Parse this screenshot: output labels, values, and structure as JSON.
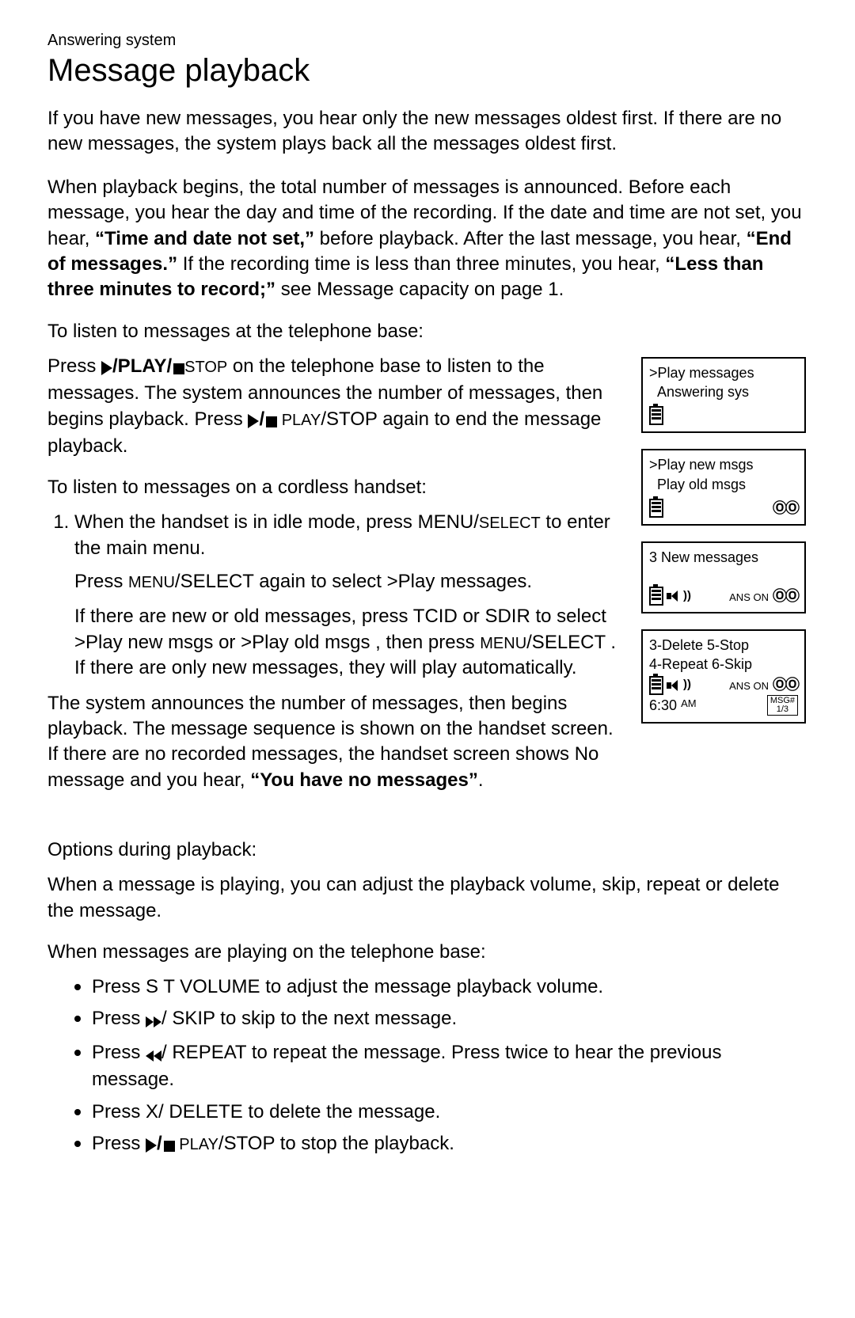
{
  "breadcrumb": "Answering system",
  "title": "Message playback",
  "p1": "If you have new messages, you hear only the new messages oldest first. If there are no new messages, the system plays back all the messages oldest first.",
  "p2_a": "When playback begins, the total number of messages is announced. Before each message, you hear the day and time of the recording. If the date and time are not set, you hear, ",
  "p2_bold1": "“Time and date not set,”",
  "p2_b": " before playback. After the last message, you hear, ",
  "p2_bold2": "“End of messages.”",
  "p2_c": " If the recording time is less than three minutes, you hear, ",
  "p2_bold3": "“Less than three minutes to record;”",
  "p2_d": " see ",
  "p2_span": "Message capacity",
  "p2_e": " on page 1.",
  "h_base": "To listen to messages at the telephone base:",
  "p_base_a": "Press ",
  "ps_label_big": "/PLAY/",
  "ps_label_stop": "STOP",
  "p_base_b": " on the telephone base to listen to the messages. The system announces the number of messages, then begins playback. Press ",
  "ps_label_small_a": "/",
  "ps_label_small_b": " PLAY",
  "ps_label_small_c": "/STOP",
  "p_base_c": " again to end the message playback.",
  "h_hand": "To listen to messages on a cordless handset:",
  "step1_a": "When the handset is in idle mode, press ",
  "step1_menu": "MENU/",
  "step1_select": "SELECT",
  "step1_b": " to enter the main menu.",
  "step_sub1_a": "Press ",
  "step_sub1_menu": "MENU",
  "step_sub1_select": "/SELECT",
  "step_sub1_b": " again to select ",
  "step_sub1_play": ">Play messages",
  "step_sub1_c": ".",
  "step_sub2_a": "If there are new or old messages, press ",
  "step_sub2_tcid": "TCID",
  "step_sub2_or": " or ",
  "step_sub2_sdir": "SDIR",
  "step_sub2_b": " to select ",
  "step_sub2_new": ">Play new msgs",
  "step_sub2_c": " or ",
  "step_sub2_old": ">Play old msgs",
  "step_sub2_d": ", then press ",
  "step_sub2_menu": "MENU",
  "step_sub2_sel": "/SELECT",
  "step_sub2_e": ". If there are only new messages, they will play automatically.",
  "p_ann_a": "The system announces the number of messages, then begins playback. The message sequence is shown on the handset screen. If there are no recorded messages, the handset screen shows ",
  "p_ann_nomsg": "No message",
  "p_ann_b": " and you hear, ",
  "p_ann_bold": "“You have no messages”",
  "p_ann_c": ".",
  "h_opt": "Options during playback:",
  "p_opt": "When a message is playing, you can adjust the playback volume, skip, repeat or delete the message.",
  "h_base2": "When messages are playing on the telephone base:",
  "b1_a": "Press ",
  "b1_vol": "S T VOLUME",
  "b1_b": " to adjust the message playback volume.",
  "b2_a": "Press ",
  "b2_skip": "/ SKIP",
  "b2_b": " to skip to the next message.",
  "b3_a": "Press ",
  "b3_rep": "/ REPEAT",
  "b3_b": " to repeat the message. Press twice to hear the previous message.",
  "b4_a": "Press ",
  "b4_del": "X/ DELETE",
  "b4_b": " to delete the message.",
  "b5_a": "Press ",
  "b5_ps": "/",
  "b5_psb": " PLAY",
  "b5_psc": "/STOP",
  "b5_b": " to stop the playback.",
  "lcd1": {
    "l1": ">Play messages",
    "l2": "Answering sys"
  },
  "lcd2": {
    "l1": ">Play new msgs",
    "l2": "Play old msgs"
  },
  "lcd3": {
    "l1": "3 New messages",
    "ans": "ANS ON"
  },
  "lcd4": {
    "l1": "3-Delete 5-Stop",
    "l2": "4-Repeat 6-Skip",
    "ans": "ANS ON",
    "time": "6:30",
    "ampm": "AM",
    "msg1": "MSG#",
    "msg2": "1/3"
  }
}
